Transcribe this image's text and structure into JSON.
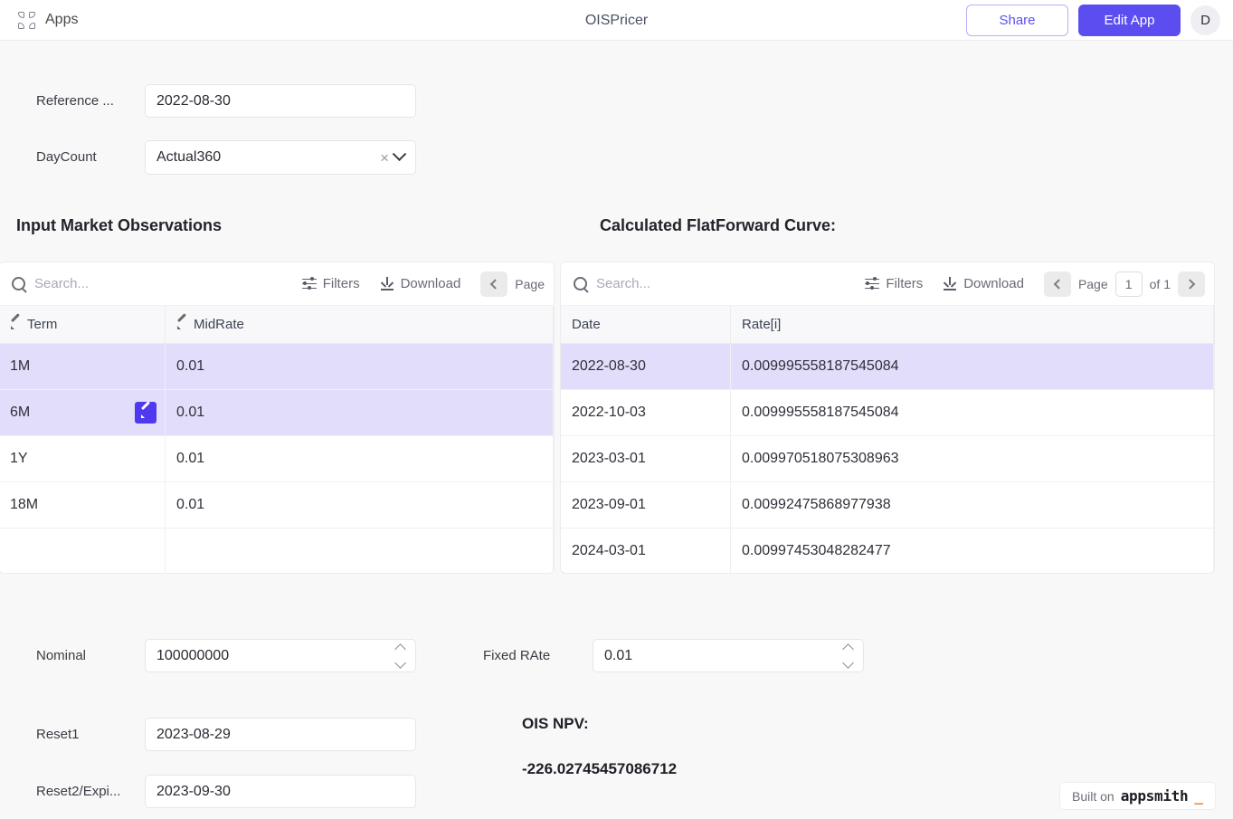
{
  "topbar": {
    "apps_label": "Apps",
    "app_title": "OISPricer",
    "share_label": "Share",
    "edit_label": "Edit App",
    "avatar_initial": "D"
  },
  "form_top": {
    "reference_label": "Reference ...",
    "reference_value": "2022-08-30",
    "daycount_label": "DayCount",
    "daycount_value": "Actual360",
    "clear_glyph": "×"
  },
  "left_panel": {
    "title": "Input Market Observations",
    "toolbar": {
      "search_placeholder": "Search...",
      "search_value": "",
      "filters_label": "Filters",
      "download_label": "Download",
      "page_label": "Page"
    },
    "columns": [
      "Term",
      "MidRate"
    ],
    "rows": [
      {
        "term": "1M",
        "midrate": "0.01",
        "selected": true,
        "edit_button": false
      },
      {
        "term": "6M",
        "midrate": "0.01",
        "selected": true,
        "edit_button": true
      },
      {
        "term": "1Y",
        "midrate": "0.01",
        "selected": false,
        "edit_button": false
      },
      {
        "term": "18M",
        "midrate": "0.01",
        "selected": false,
        "edit_button": false
      },
      {
        "term": "",
        "midrate": "",
        "selected": false,
        "edit_button": false
      }
    ]
  },
  "right_panel": {
    "title": "Calculated FlatForward Curve:",
    "toolbar": {
      "search_placeholder": "Search...",
      "search_value": "",
      "filters_label": "Filters",
      "download_label": "Download",
      "page_label": "Page",
      "page_number": "1",
      "page_of": "of 1"
    },
    "columns": [
      "Date",
      "Rate[i]"
    ],
    "rows": [
      {
        "date": "2022-08-30",
        "rate": "0.009995558187545084",
        "selected": true
      },
      {
        "date": "2022-10-03",
        "rate": "0.009995558187545084",
        "selected": false
      },
      {
        "date": "2023-03-01",
        "rate": "0.009970518075308963",
        "selected": false
      },
      {
        "date": "2023-09-01",
        "rate": "0.00992475868977938",
        "selected": false
      },
      {
        "date": "2024-03-01",
        "rate": "0.00997453048282477",
        "selected": false
      }
    ]
  },
  "form_bottom": {
    "nominal_label": "Nominal",
    "nominal_value": "100000000",
    "fixedrate_label": "Fixed RAte",
    "fixedrate_value": "0.01",
    "reset1_label": "Reset1",
    "reset1_value": "2023-08-29",
    "reset2_label": "Reset2/Expi...",
    "reset2_value": "2023-09-30"
  },
  "npv": {
    "label": "OIS NPV:",
    "value": "-226.02745457086712"
  },
  "footer": {
    "built_on": "Built on",
    "brand": "appsmith",
    "cursor": "_"
  },
  "colors": {
    "accent": "#5b4df0",
    "selected_row": "#e2ddfa",
    "page_bg": "#f8f8f8",
    "brand_cursor": "#e8833a"
  }
}
